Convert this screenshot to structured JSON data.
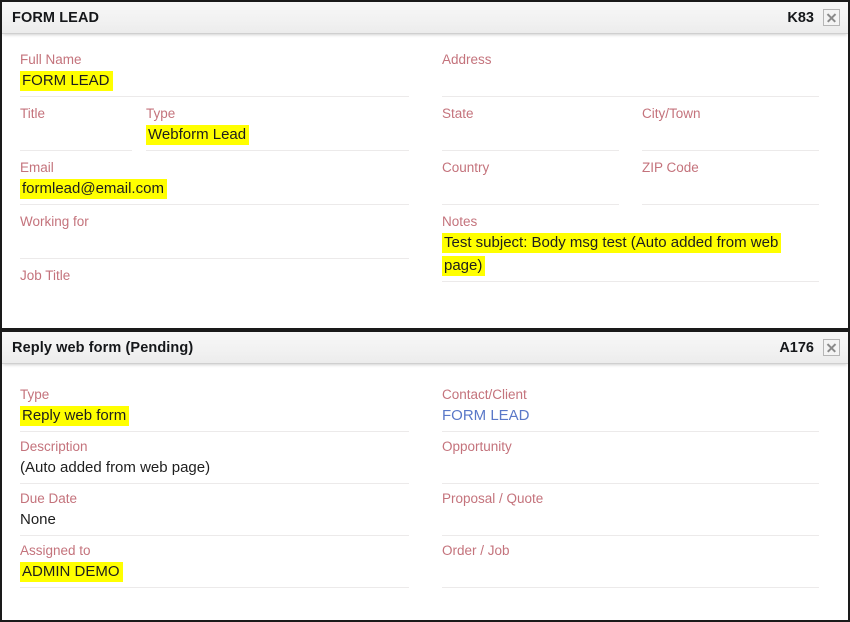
{
  "panels": [
    {
      "id": "lead-panel",
      "title": "FORM LEAD",
      "code": "K83",
      "close_icon": "close-icon",
      "left_fields": [
        {
          "label": "Full Name",
          "value": "FORM LEAD",
          "highlight": true
        },
        {
          "label": "Title",
          "value": ""
        },
        {
          "label": "Type",
          "value": "Webform Lead",
          "highlight": true
        },
        {
          "label": "Email",
          "value": "formlead@email.com",
          "highlight": true
        },
        {
          "label": "Working for",
          "value": ""
        },
        {
          "label": "Job Title",
          "value": ""
        }
      ],
      "right_fields": [
        {
          "label": "Address",
          "value": ""
        },
        {
          "label": "State",
          "value": ""
        },
        {
          "label": "City/Town",
          "value": ""
        },
        {
          "label": "Country",
          "value": ""
        },
        {
          "label": "ZIP Code",
          "value": ""
        },
        {
          "label": "Notes",
          "value": "Test subject: Body msg test (Auto added from web page)",
          "highlight": true
        }
      ]
    },
    {
      "id": "activity-panel",
      "title": "Reply web form (Pending)",
      "code": "A176",
      "close_icon": "close-icon",
      "left_fields": [
        {
          "label": "Type",
          "value": "Reply web form",
          "highlight": true
        },
        {
          "label": "Description",
          "value": "(Auto added from web page)"
        },
        {
          "label": "Due Date",
          "value": "None"
        },
        {
          "label": "Assigned to",
          "value": "ADMIN DEMO",
          "highlight": true
        }
      ],
      "right_fields": [
        {
          "label": "Contact/Client",
          "value": "FORM LEAD",
          "link": true
        },
        {
          "label": "Opportunity",
          "value": ""
        },
        {
          "label": "Proposal / Quote",
          "value": ""
        },
        {
          "label": "Order / Job",
          "value": ""
        }
      ]
    }
  ],
  "colors": {
    "label": "#c4737c",
    "highlight": "#ffff00",
    "link": "#5a78c8",
    "divider": "#eceaea",
    "panel_border": "#1a1a1a",
    "titlebar": "#f2f2f2"
  }
}
